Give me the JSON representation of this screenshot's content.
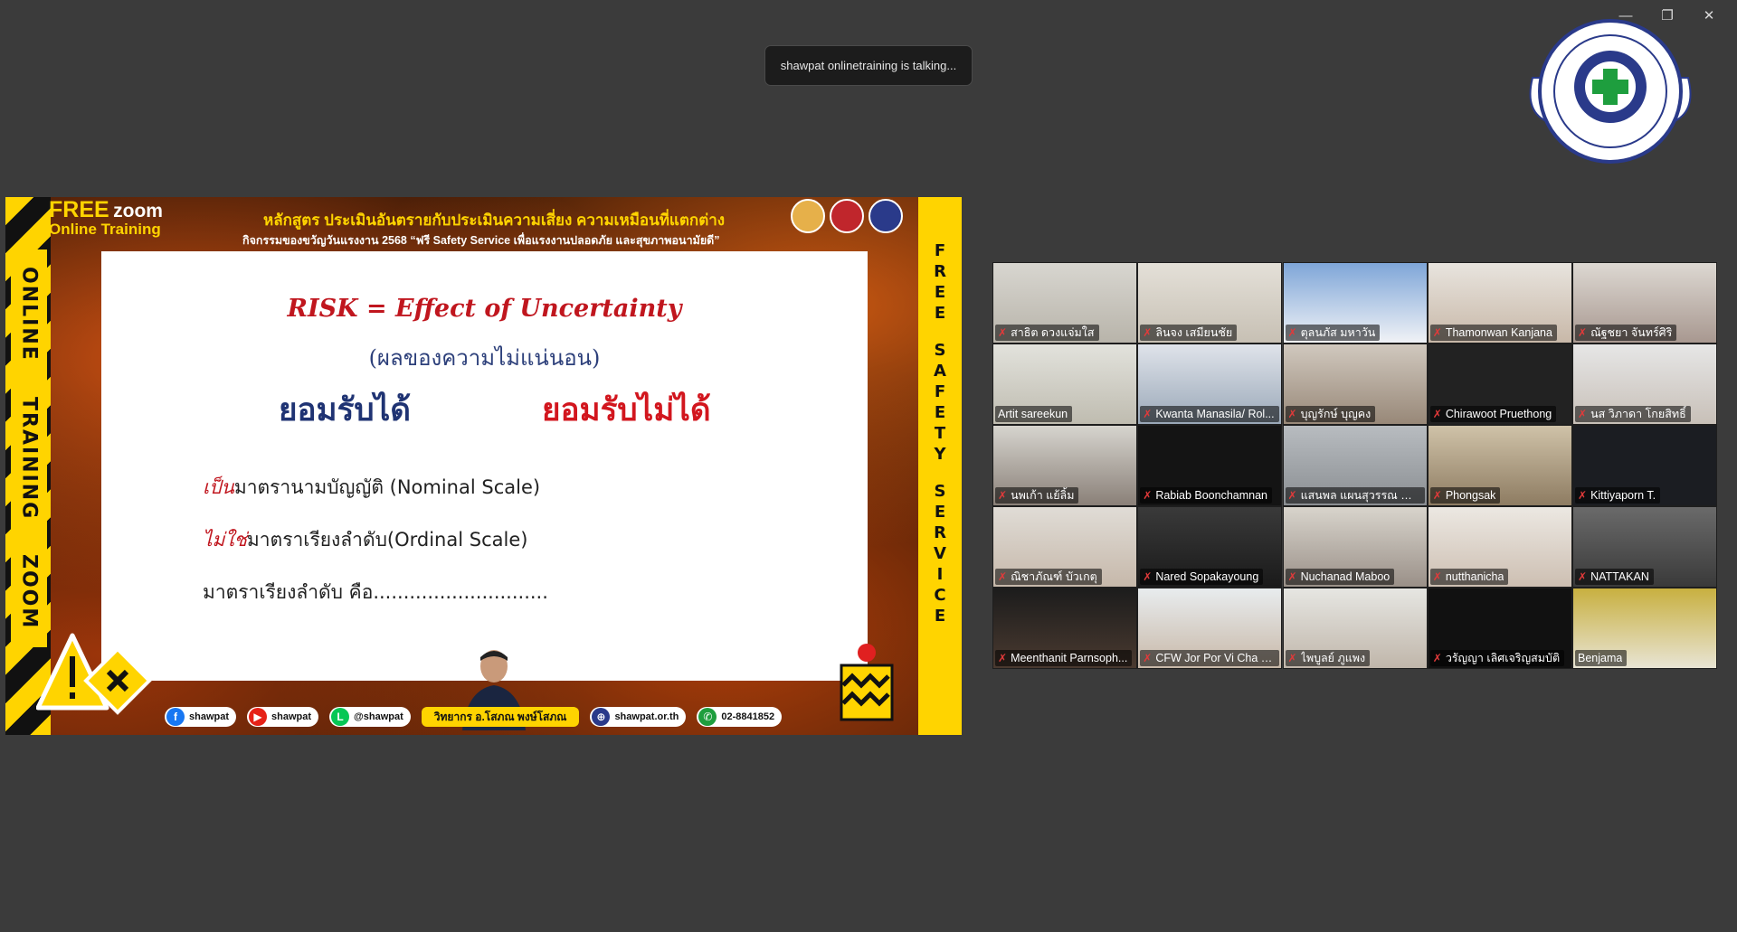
{
  "window": {
    "minimize_icon": "minimize-icon",
    "restore_icon": "restore-icon",
    "close_icon": "close-icon",
    "minimize_glyph": "—",
    "restore_glyph": "❐",
    "close_glyph": "✕"
  },
  "toast": {
    "text": "shawpat onlinetraining is talking..."
  },
  "share": {
    "brand_free": "FREE",
    "brand_zoom": "zoom",
    "brand_online": "Online Training",
    "header_title": "หลักสูตร ประเมินอันตรายกับประเมินความเสี่ยง ความเหมือนที่แตกต่าง",
    "header_subtitle": "กิจกรรมของขวัญวันแรงงาน 2568 “ฟรี Safety Service เพื่อแรงงานปลอดภัย และสุขภาพอนามัยดี”",
    "left_band": [
      "ONLINE",
      "TRAINING",
      "ZOOM"
    ],
    "right_band_1": [
      "F",
      "R",
      "E",
      "E"
    ],
    "right_band_2": [
      "S",
      "A",
      "F",
      "E",
      "T",
      "Y"
    ],
    "right_band_3": [
      "S",
      "E",
      "R",
      "V",
      "I",
      "C",
      "E"
    ],
    "slide": {
      "risk_title": "RISK = Effect of Uncertainty",
      "risk_subtitle": "(ผลของความไม่แน่นอน)",
      "acceptable": "ยอมรับได้",
      "unacceptable": "ยอมรับไม่ได้",
      "line1_hl": "เป็น",
      "line1_rest": "มาตรานามบัญญัติ (Nominal Scale)",
      "line2_hl": "ไม่ใช่",
      "line2_rest": "มาตราเรียงลำดับ(Ordinal Scale)",
      "line3": "มาตราเรียงลำดับ  คือ............................."
    },
    "footer": {
      "facebook": "shawpat",
      "youtube": "shawpat",
      "line": "@shawpat",
      "speaker": "วิทยากร อ.โสภณ พงษ์โสภณ",
      "web": "shawpat.or.th",
      "phone": "02-8841852"
    },
    "colors": {
      "hazard_yellow": "#ffd400",
      "risk_red": "#c0161e",
      "accept_blue": "#1f3373"
    }
  },
  "gallery": {
    "participants": [
      {
        "name": "สาธิต ดวงแจ่มใส",
        "muted": true
      },
      {
        "name": "ลินจง เสมียนชัย",
        "muted": true
      },
      {
        "name": "ตุลนภัส มหาวัน",
        "muted": true
      },
      {
        "name": "Thamonwan Kanjana",
        "muted": true
      },
      {
        "name": "ณัฐชยา จันทร์ศิริ",
        "muted": true
      },
      {
        "name": "Artit  sareekun",
        "muted": false
      },
      {
        "name": "Kwanta Manasila/ Rol...",
        "muted": true
      },
      {
        "name": "บุญรักษ์ บุญคง",
        "muted": true
      },
      {
        "name": "Chirawoot Pruethong",
        "muted": true
      },
      {
        "name": "นส วิภาดา โกยสิทธิ์",
        "muted": true
      },
      {
        "name": "นพเก้า แย้ลิ้ม",
        "muted": true
      },
      {
        "name": "Rabiab Boonchamnan",
        "muted": true
      },
      {
        "name": "แสนพล แผนสุวรรณ Rol...",
        "muted": true
      },
      {
        "name": "Phongsak",
        "muted": true
      },
      {
        "name": "Kittiyaporn T.",
        "muted": true
      },
      {
        "name": "ณิชาภัณฑ์ บัวเกตุ",
        "muted": true
      },
      {
        "name": "Nared Sopakayoung",
        "muted": true
      },
      {
        "name": "Nuchanad  Maboo",
        "muted": true
      },
      {
        "name": "nutthanicha",
        "muted": true
      },
      {
        "name": "NATTAKAN",
        "muted": true
      },
      {
        "name": "Meenthanit Parnsoph...",
        "muted": true
      },
      {
        "name": "CFW Jor Por Vi Cha C...",
        "muted": true
      },
      {
        "name": "ไพบูลย์ ภูแพง",
        "muted": true
      },
      {
        "name": "วรัญญา เลิศเจริญสมบัติ",
        "muted": true
      },
      {
        "name": "Benjama",
        "muted": false
      }
    ],
    "mic_icon": "mic-muted-icon",
    "mic_glyph": "✗"
  }
}
